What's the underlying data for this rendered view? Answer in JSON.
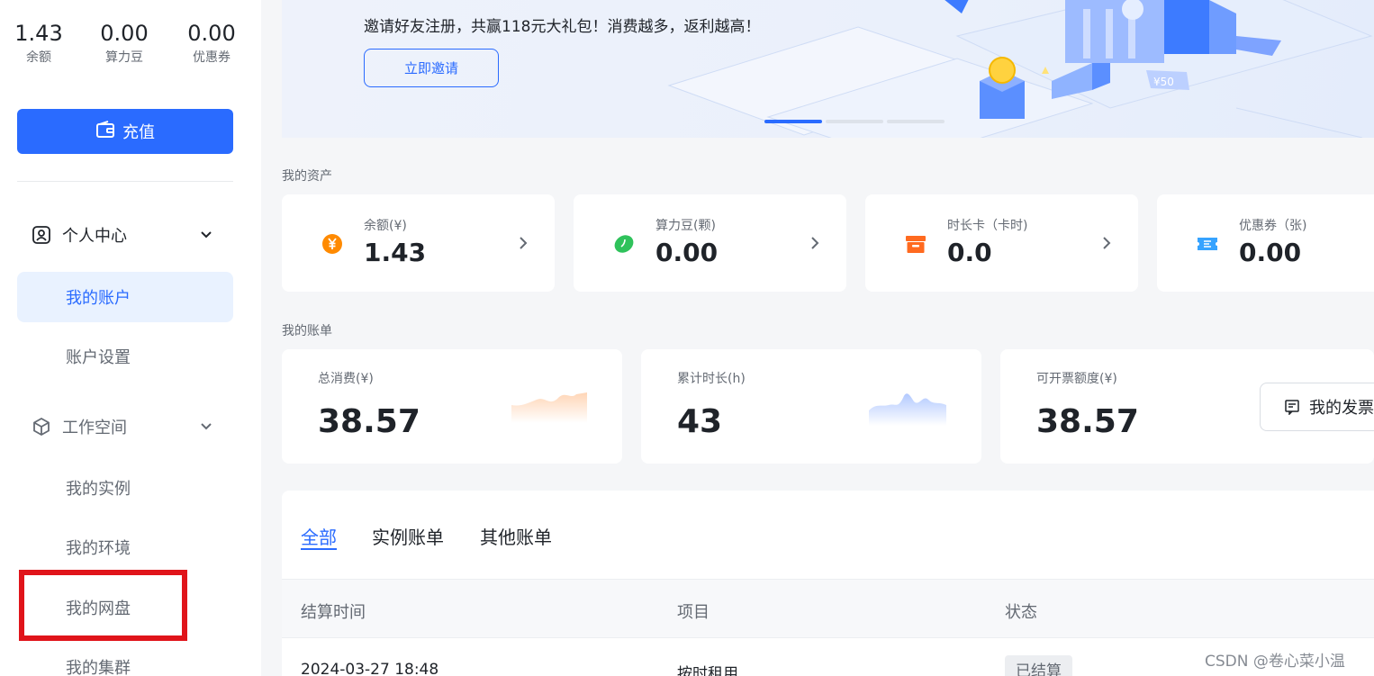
{
  "sidebar": {
    "stats": [
      {
        "value": "1.43",
        "label": "余额"
      },
      {
        "value": "0.00",
        "label": "算力豆"
      },
      {
        "value": "0.00",
        "label": "优惠券"
      }
    ],
    "recharge_label": "充值",
    "groups": [
      {
        "label": "个人中心",
        "icon": "user-card-icon"
      },
      {
        "label": "工作空间",
        "icon": "cube-icon"
      }
    ],
    "items": [
      {
        "label": "我的账户",
        "active": true
      },
      {
        "label": "账户设置"
      },
      {
        "label": "我的实例"
      },
      {
        "label": "我的环境"
      },
      {
        "label": "我的网盘"
      },
      {
        "label": "我的集群"
      }
    ]
  },
  "banner": {
    "text": "邀请好友注册，共赢118元大礼包！消费越多，返利越高！",
    "button_label": "立即邀请",
    "coupon_text": "¥50",
    "carousel_active_index": 0
  },
  "assets": {
    "title": "我的资产",
    "cards": [
      {
        "label": "余额(¥)",
        "value": "1.43",
        "icon": "yuan-coin-icon",
        "color": "#ff8a00"
      },
      {
        "label": "算力豆(颗)",
        "value": "0.00",
        "icon": "bean-icon",
        "color": "#2fc25b"
      },
      {
        "label": "时长卡（卡时)",
        "value": "0.0",
        "icon": "box-card-icon",
        "color": "#ff6a1f"
      },
      {
        "label": "优惠券（张)",
        "value": "0.00",
        "icon": "ticket-icon",
        "color": "#36a3ff"
      }
    ]
  },
  "bills": {
    "title": "我的账单",
    "cards": [
      {
        "label": "总消费(¥)",
        "value": "38.57",
        "spark_color": "#ffb37a"
      },
      {
        "label": "累计时长(h)",
        "value": "43",
        "spark_color": "#7fa5ff"
      },
      {
        "label": "可开票额度(¥)",
        "value": "38.57"
      }
    ],
    "invoice_button": "我的发票"
  },
  "table": {
    "tabs": [
      "全部",
      "实例账单",
      "其他账单"
    ],
    "active_tab": 0,
    "columns": [
      "结算时间",
      "项目",
      "状态"
    ],
    "rows": [
      {
        "time": "2024-03-27 18:48",
        "item": "按时租用",
        "status": "已结算"
      }
    ]
  },
  "watermark": "CSDN @卷心菜小温",
  "colors": {
    "accent": "#2a6bff",
    "active_bg": "#e9f2ff",
    "highlight_box": "#e0141a"
  }
}
